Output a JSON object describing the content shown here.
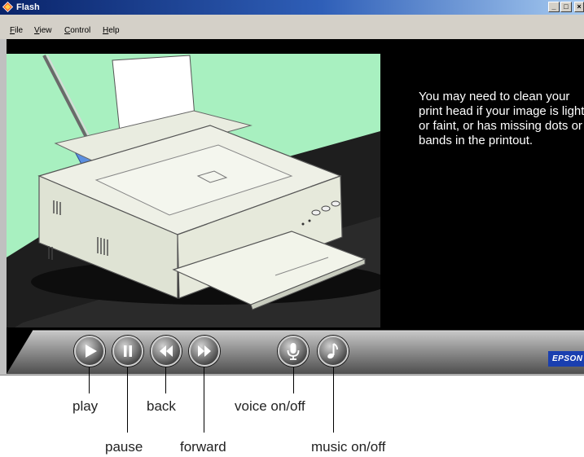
{
  "window": {
    "title": "Flash",
    "minimize_symbol": "_",
    "maximize_symbol": "□",
    "close_symbol": "×"
  },
  "menu": [
    {
      "label": "File",
      "accel": "F",
      "rest": "ile"
    },
    {
      "label": "View",
      "accel": "V",
      "rest": "iew"
    },
    {
      "label": "Control",
      "accel": "C",
      "rest": "ontrol"
    },
    {
      "label": "Help",
      "accel": "H",
      "rest": "elp"
    }
  ],
  "message": "You may need to clean your print head if your image is light or faint, or has missing dots or bands in the printout.",
  "controls": [
    {
      "name": "play",
      "icon": "play-icon"
    },
    {
      "name": "pause",
      "icon": "pause-icon"
    },
    {
      "name": "back",
      "icon": "rewind-icon"
    },
    {
      "name": "forward",
      "icon": "fast-forward-icon"
    },
    {
      "name": "voice on/off",
      "icon": "microphone-icon"
    },
    {
      "name": "music on/off",
      "icon": "music-note-icon"
    }
  ],
  "logo_text": "EPSON",
  "callouts": {
    "play": "play",
    "pause": "pause",
    "back": "back",
    "forward": "forward",
    "voice": "voice on/off",
    "music": "music on/off"
  },
  "colors": {
    "illustration_bg": "#a8f0c0",
    "titlebar_start": "#0a246a",
    "logo_bg": "#1a3fb0"
  }
}
